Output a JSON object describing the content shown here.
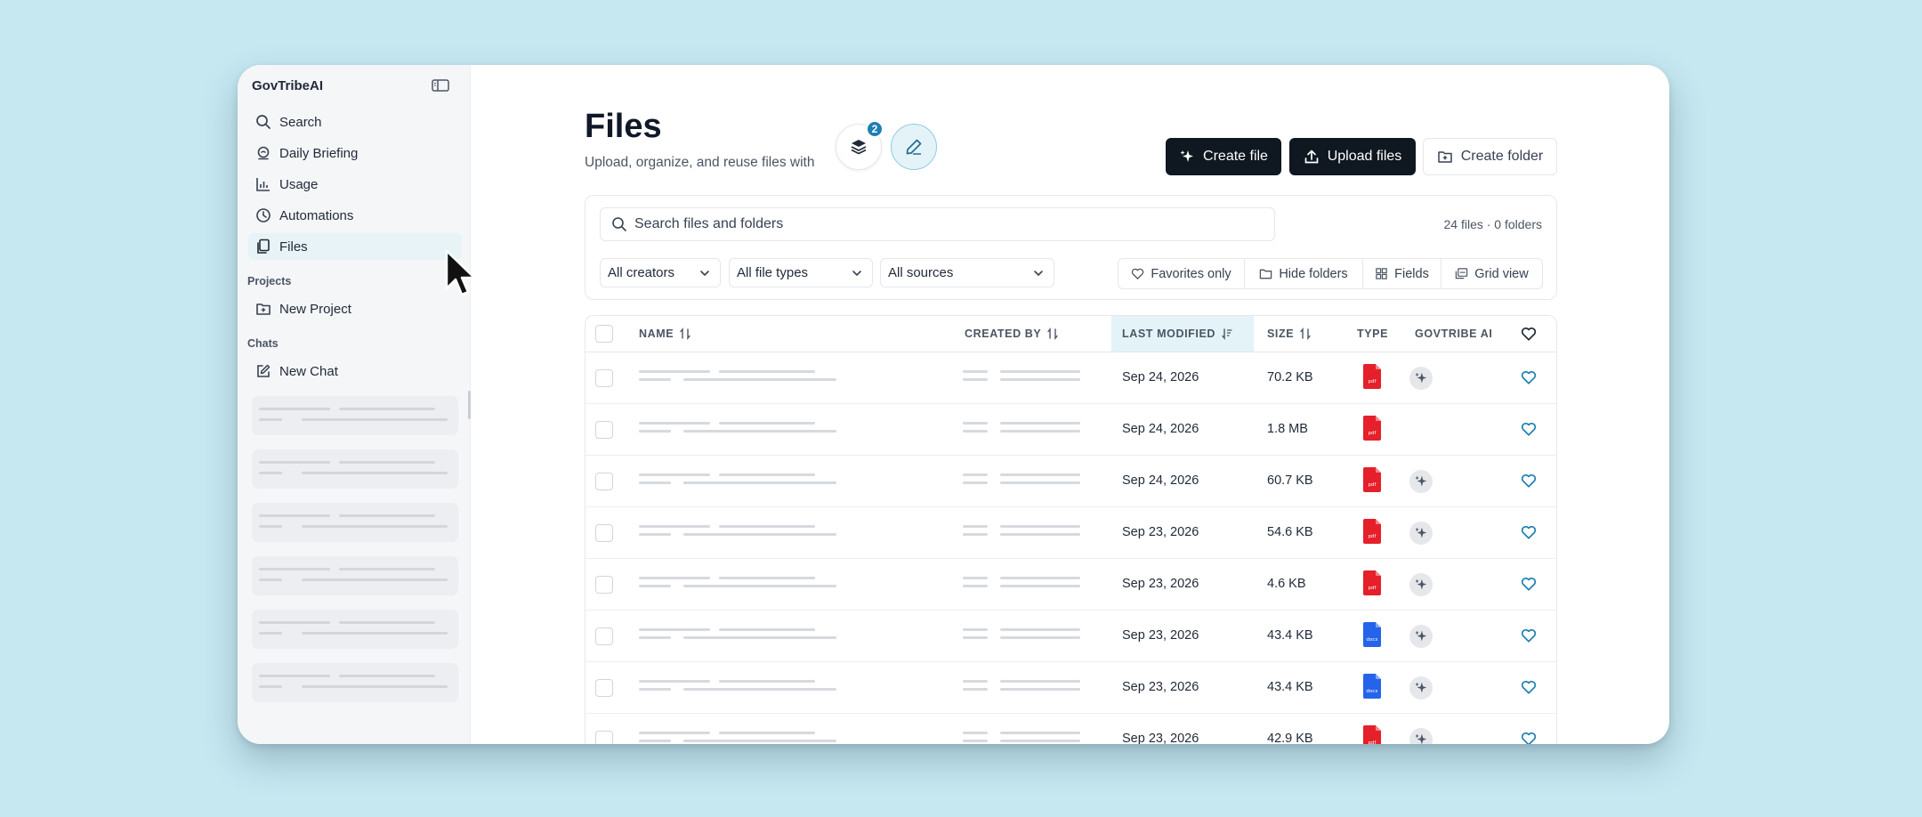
{
  "app": {
    "name": "GovTribeAI",
    "accent_color": "#1f7fb3",
    "background_color": "#c5e8f1"
  },
  "sidebar": {
    "nav": [
      {
        "label": "Search",
        "icon": "search-icon"
      },
      {
        "label": "Daily Briefing",
        "icon": "briefing-icon"
      },
      {
        "label": "Usage",
        "icon": "usage-chart-icon"
      },
      {
        "label": "Automations",
        "icon": "clock-icon"
      },
      {
        "label": "Files",
        "icon": "files-icon",
        "active": true
      }
    ],
    "projects_label": "Projects",
    "new_project_label": "New Project",
    "chats_label": "Chats",
    "new_chat_label": "New Chat"
  },
  "header": {
    "title": "Files",
    "subtitle": "Upload, organize, and reuse files with",
    "badge_count": "2",
    "create_file_label": "Create file",
    "upload_files_label": "Upload files",
    "create_folder_label": "Create folder"
  },
  "filters": {
    "search_placeholder": "Search files and folders",
    "counts": "24 files · 0 folders",
    "creators_selected": "All creators",
    "file_types_selected": "All file types",
    "sources_selected": "All sources",
    "favorites_only_label": "Favorites only",
    "hide_folders_label": "Hide folders",
    "fields_label": "Fields",
    "grid_view_label": "Grid view"
  },
  "table": {
    "columns": {
      "name": "NAME",
      "created_by": "CREATED BY",
      "last_modified": "LAST MODIFIED",
      "size": "SIZE",
      "type": "TYPE",
      "govtribe_ai": "GOVTRIBE AI"
    },
    "rows": [
      {
        "modified": "Sep 24, 2026",
        "size": "70.2 KB",
        "type": "pdf",
        "ai": true
      },
      {
        "modified": "Sep 24, 2026",
        "size": "1.8 MB",
        "type": "pdf",
        "ai": false
      },
      {
        "modified": "Sep 24, 2026",
        "size": "60.7 KB",
        "type": "pdf",
        "ai": true
      },
      {
        "modified": "Sep 23, 2026",
        "size": "54.6 KB",
        "type": "pdf",
        "ai": true
      },
      {
        "modified": "Sep 23, 2026",
        "size": "4.6 KB",
        "type": "pdf",
        "ai": true
      },
      {
        "modified": "Sep 23, 2026",
        "size": "43.4 KB",
        "type": "docx",
        "ai": true
      },
      {
        "modified": "Sep 23, 2026",
        "size": "43.4 KB",
        "type": "docx",
        "ai": true
      },
      {
        "modified": "Sep 23, 2026",
        "size": "42.9 KB",
        "type": "pdf",
        "ai": true
      }
    ]
  },
  "file_type_colors": {
    "pdf": "#e5202a",
    "docx": "#2563eb"
  }
}
